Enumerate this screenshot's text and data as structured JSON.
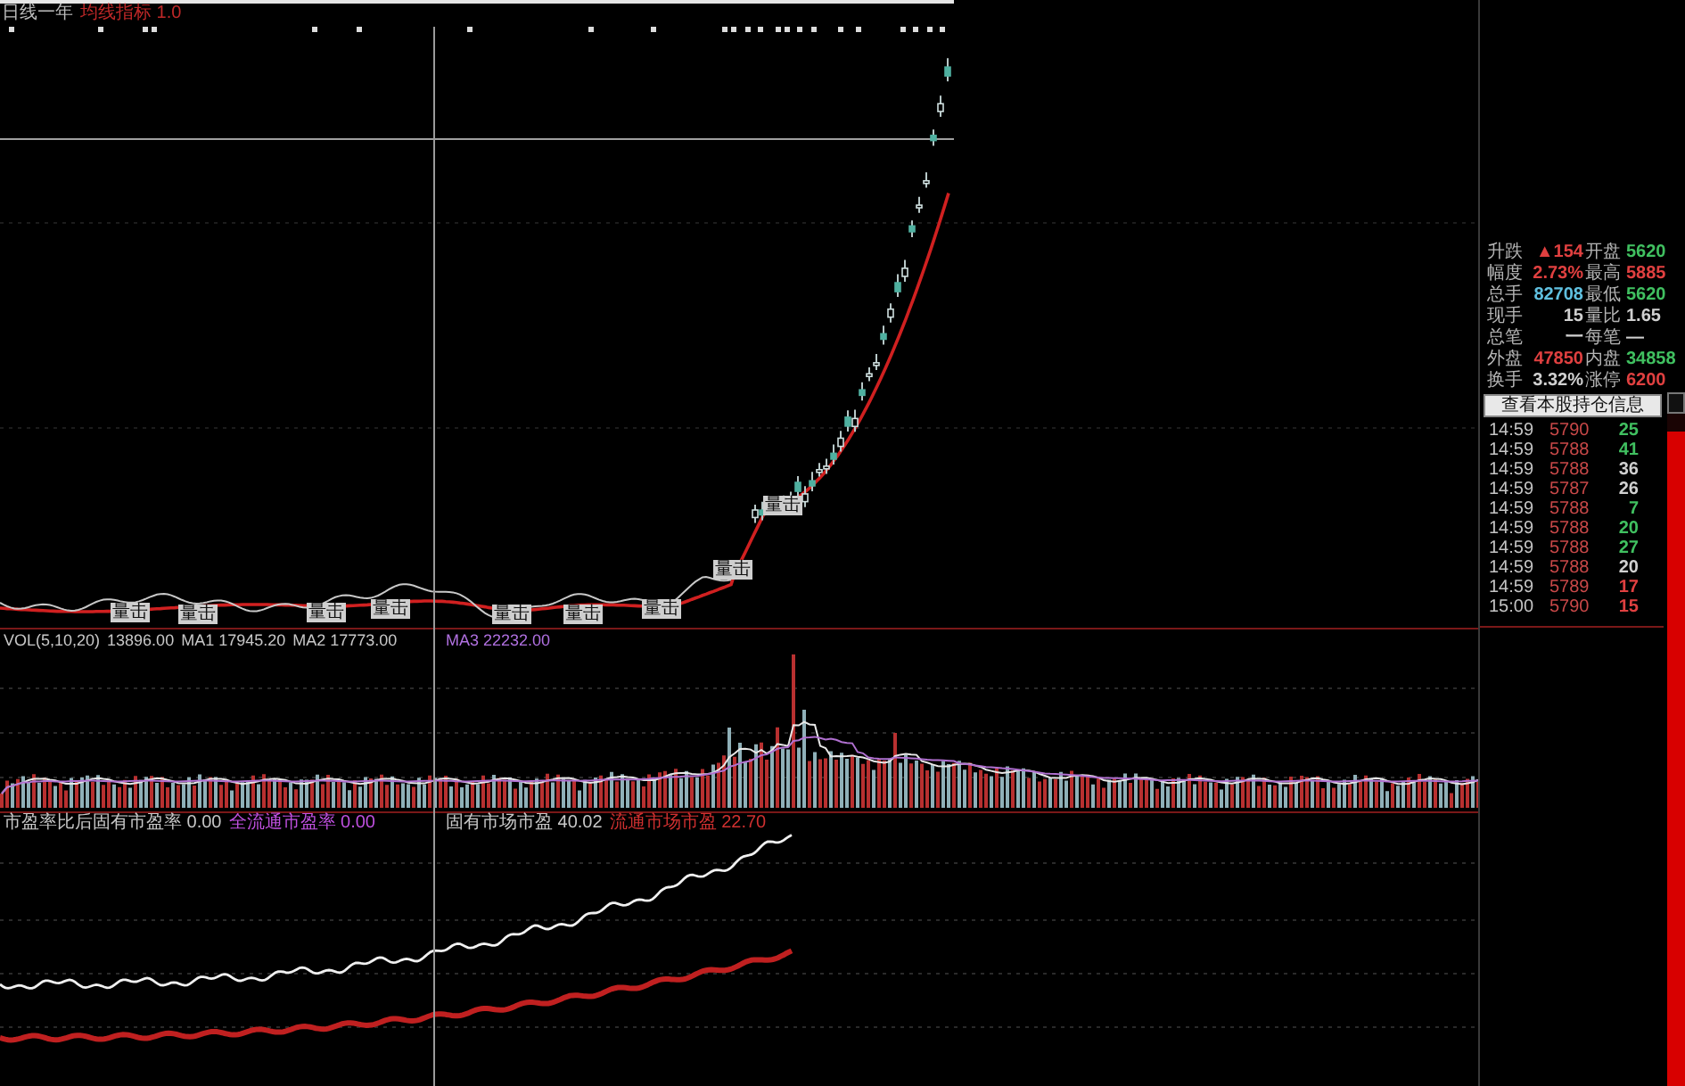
{
  "header": {
    "period": "日线一年",
    "indicator": "均线指标 1.0"
  },
  "price_chart": {
    "signals": [
      {
        "label": "量击"
      },
      {
        "label": "量击"
      },
      {
        "label": "量击"
      },
      {
        "label": "量击"
      },
      {
        "label": "量击"
      },
      {
        "label": "量击"
      },
      {
        "label": "量击"
      },
      {
        "label": "量击"
      },
      {
        "label": "量击"
      }
    ]
  },
  "volume_panel": {
    "legend": [
      {
        "text": "VOL(5,10,20)",
        "color": "#c8c8c8"
      },
      {
        "text": "13896.00",
        "color": "#c8c8c8"
      },
      {
        "text": "MA1 17945.20",
        "color": "#c8c8c8"
      },
      {
        "text": "MA2 17773.00",
        "color": "#c8c8c8"
      },
      {
        "text": "MA3 22232.00",
        "color": "#b070e0"
      }
    ]
  },
  "indicator_panel": {
    "legend": [
      {
        "text": "市盈率比后固有市盈率 0.00",
        "color": "#c8c8c8"
      },
      {
        "text": "全流通市盈率 0.00",
        "color": "#c050e0"
      },
      {
        "text": "固有市场市盈 40.02",
        "color": "#c8c8c8"
      },
      {
        "text": "流通市场市盈 22.70",
        "color": "#d03030"
      }
    ]
  },
  "quote_panel": {
    "fields": [
      {
        "left": {
          "label": "升跌",
          "value": "▲154",
          "color": "#e04040"
        },
        "right": {
          "label": "开盘",
          "value": "5620",
          "color": "#40c060"
        }
      },
      {
        "left": {
          "label": "幅度",
          "value": "2.73%",
          "color": "#e04040"
        },
        "right": {
          "label": "最高",
          "value": "5885",
          "color": "#e04040"
        }
      },
      {
        "left": {
          "label": "总手",
          "value": "82708",
          "color": "#60c0e0"
        },
        "right": {
          "label": "最低",
          "value": "5620",
          "color": "#40c060"
        }
      },
      {
        "left": {
          "label": "现手",
          "value": "15",
          "color": "#d0d0d0"
        },
        "right": {
          "label": "量比",
          "value": "1.65",
          "color": "#d0d0d0"
        }
      },
      {
        "left": {
          "label": "总笔",
          "value": "一",
          "color": "#d0d0d0"
        },
        "right": {
          "label": "每笔",
          "value": "—",
          "color": "#d0d0d0"
        }
      },
      {
        "left": {
          "label": "外盘",
          "value": "47850",
          "color": "#e04040"
        },
        "right": {
          "label": "内盘",
          "value": "34858",
          "color": "#40c060"
        }
      },
      {
        "left": {
          "label": "换手",
          "value": "3.32%",
          "color": "#d0d0d0"
        },
        "right": {
          "label": "涨停",
          "value": "6200",
          "color": "#e04040"
        }
      }
    ],
    "holdings_button": "查看本股持仓信息",
    "ticks": [
      {
        "time": "14:59",
        "price": "5790",
        "volume": "25",
        "color": "#40c060"
      },
      {
        "time": "14:59",
        "price": "5788",
        "volume": "41",
        "color": "#40c060"
      },
      {
        "time": "14:59",
        "price": "5788",
        "volume": "36",
        "color": "#d0d0d0"
      },
      {
        "time": "14:59",
        "price": "5787",
        "volume": "26",
        "color": "#d0d0d0"
      },
      {
        "time": "14:59",
        "price": "5788",
        "volume": "7",
        "color": "#40c060"
      },
      {
        "time": "14:59",
        "price": "5788",
        "volume": "20",
        "color": "#40c060"
      },
      {
        "time": "14:59",
        "price": "5788",
        "volume": "27",
        "color": "#40c060"
      },
      {
        "time": "14:59",
        "price": "5788",
        "volume": "20",
        "color": "#d0d0d0"
      },
      {
        "time": "14:59",
        "price": "5789",
        "volume": "17",
        "color": "#e04040"
      },
      {
        "time": "15:00",
        "price": "5790",
        "volume": "15",
        "color": "#e04040"
      }
    ]
  }
}
